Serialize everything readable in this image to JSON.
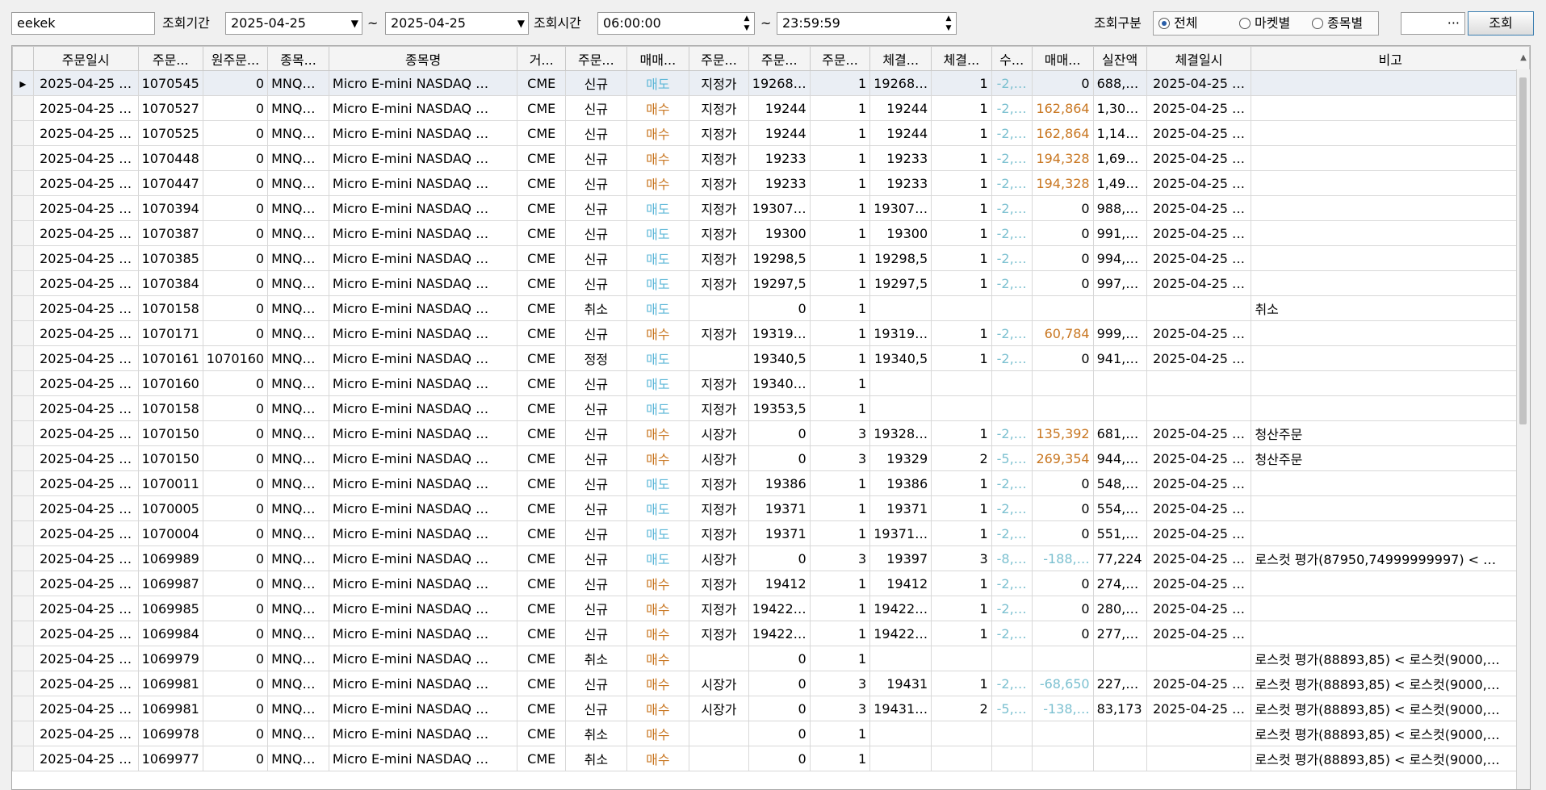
{
  "toolbar": {
    "account": "eekek",
    "period_label": "조회기간",
    "start_date": "2025-04-25",
    "tilde": "~",
    "end_date": "2025-04-25",
    "time_label": "조회시간",
    "start_time": "06:00:00",
    "end_time": "23:59:59",
    "type_label": "조회구분",
    "radio_all": "전체",
    "radio_market": "마켓별",
    "radio_symbol": "종목별",
    "selected_radio": "all",
    "picker_button": "···",
    "search_button": "조회"
  },
  "columns": [
    "주문일시",
    "주문...",
    "원주문...",
    "종목...",
    "종목명",
    "거...",
    "주문...",
    "매매...",
    "주문...",
    "주문...",
    "주문...",
    "체결...",
    "체결...",
    "수...",
    "매매...",
    "실잔액",
    "체결일시",
    "비고"
  ],
  "rows": [
    [
      "2025-04-25 …",
      "1070545",
      "0",
      "MNQ…",
      "Micro E-mini NASDAQ …",
      "CME",
      "신규",
      "매도",
      "지정가",
      "19268…",
      "1",
      "19268…",
      "1",
      "-2,…",
      "0",
      "688,…",
      "2025-04-25 …",
      ""
    ],
    [
      "2025-04-25 …",
      "1070527",
      "0",
      "MNQ…",
      "Micro E-mini NASDAQ …",
      "CME",
      "신규",
      "매수",
      "지정가",
      "19244",
      "1",
      "19244",
      "1",
      "-2,…",
      "162,864",
      "1,30…",
      "2025-04-25 …",
      ""
    ],
    [
      "2025-04-25 …",
      "1070525",
      "0",
      "MNQ…",
      "Micro E-mini NASDAQ …",
      "CME",
      "신규",
      "매수",
      "지정가",
      "19244",
      "1",
      "19244",
      "1",
      "-2,…",
      "162,864",
      "1,14…",
      "2025-04-25 …",
      ""
    ],
    [
      "2025-04-25 …",
      "1070448",
      "0",
      "MNQ…",
      "Micro E-mini NASDAQ …",
      "CME",
      "신규",
      "매수",
      "지정가",
      "19233",
      "1",
      "19233",
      "1",
      "-2,…",
      "194,328",
      "1,69…",
      "2025-04-25 …",
      ""
    ],
    [
      "2025-04-25 …",
      "1070447",
      "0",
      "MNQ…",
      "Micro E-mini NASDAQ …",
      "CME",
      "신규",
      "매수",
      "지정가",
      "19233",
      "1",
      "19233",
      "1",
      "-2,…",
      "194,328",
      "1,49…",
      "2025-04-25 …",
      ""
    ],
    [
      "2025-04-25 …",
      "1070394",
      "0",
      "MNQ…",
      "Micro E-mini NASDAQ …",
      "CME",
      "신규",
      "매도",
      "지정가",
      "19307…",
      "1",
      "19307…",
      "1",
      "-2,…",
      "0",
      "988,…",
      "2025-04-25 …",
      ""
    ],
    [
      "2025-04-25 …",
      "1070387",
      "0",
      "MNQ…",
      "Micro E-mini NASDAQ …",
      "CME",
      "신규",
      "매도",
      "지정가",
      "19300",
      "1",
      "19300",
      "1",
      "-2,…",
      "0",
      "991,…",
      "2025-04-25 …",
      ""
    ],
    [
      "2025-04-25 …",
      "1070385",
      "0",
      "MNQ…",
      "Micro E-mini NASDAQ …",
      "CME",
      "신규",
      "매도",
      "지정가",
      "19298,5",
      "1",
      "19298,5",
      "1",
      "-2,…",
      "0",
      "994,…",
      "2025-04-25 …",
      ""
    ],
    [
      "2025-04-25 …",
      "1070384",
      "0",
      "MNQ…",
      "Micro E-mini NASDAQ …",
      "CME",
      "신규",
      "매도",
      "지정가",
      "19297,5",
      "1",
      "19297,5",
      "1",
      "-2,…",
      "0",
      "997,…",
      "2025-04-25 …",
      ""
    ],
    [
      "2025-04-25 …",
      "1070158",
      "0",
      "MNQ…",
      "Micro E-mini NASDAQ …",
      "CME",
      "취소",
      "매도",
      "",
      "0",
      "1",
      "",
      "",
      "",
      "",
      "",
      "",
      "취소"
    ],
    [
      "2025-04-25 …",
      "1070171",
      "0",
      "MNQ…",
      "Micro E-mini NASDAQ …",
      "CME",
      "신규",
      "매수",
      "지정가",
      "19319…",
      "1",
      "19319…",
      "1",
      "-2,…",
      "60,784",
      "999,…",
      "2025-04-25 …",
      ""
    ],
    [
      "2025-04-25 …",
      "1070161",
      "1070160",
      "MNQ…",
      "Micro E-mini NASDAQ …",
      "CME",
      "정정",
      "매도",
      "",
      "19340,5",
      "1",
      "19340,5",
      "1",
      "-2,…",
      "0",
      "941,…",
      "2025-04-25 …",
      ""
    ],
    [
      "2025-04-25 …",
      "1070160",
      "0",
      "MNQ…",
      "Micro E-mini NASDAQ …",
      "CME",
      "신규",
      "매도",
      "지정가",
      "19340…",
      "1",
      "",
      "",
      "",
      "",
      "",
      "",
      ""
    ],
    [
      "2025-04-25 …",
      "1070158",
      "0",
      "MNQ…",
      "Micro E-mini NASDAQ …",
      "CME",
      "신규",
      "매도",
      "지정가",
      "19353,5",
      "1",
      "",
      "",
      "",
      "",
      "",
      "",
      ""
    ],
    [
      "2025-04-25 …",
      "1070150",
      "0",
      "MNQ…",
      "Micro E-mini NASDAQ …",
      "CME",
      "신규",
      "매수",
      "시장가",
      "0",
      "3",
      "19328…",
      "1",
      "-2,…",
      "135,392",
      "681,…",
      "2025-04-25 …",
      "청산주문"
    ],
    [
      "2025-04-25 …",
      "1070150",
      "0",
      "MNQ…",
      "Micro E-mini NASDAQ …",
      "CME",
      "신규",
      "매수",
      "시장가",
      "0",
      "3",
      "19329",
      "2",
      "-5,…",
      "269,354",
      "944,…",
      "2025-04-25 …",
      "청산주문"
    ],
    [
      "2025-04-25 …",
      "1070011",
      "0",
      "MNQ…",
      "Micro E-mini NASDAQ …",
      "CME",
      "신규",
      "매도",
      "지정가",
      "19386",
      "1",
      "19386",
      "1",
      "-2,…",
      "0",
      "548,…",
      "2025-04-25 …",
      ""
    ],
    [
      "2025-04-25 …",
      "1070005",
      "0",
      "MNQ…",
      "Micro E-mini NASDAQ …",
      "CME",
      "신규",
      "매도",
      "지정가",
      "19371",
      "1",
      "19371",
      "1",
      "-2,…",
      "0",
      "554,…",
      "2025-04-25 …",
      ""
    ],
    [
      "2025-04-25 …",
      "1070004",
      "0",
      "MNQ…",
      "Micro E-mini NASDAQ …",
      "CME",
      "신규",
      "매도",
      "지정가",
      "19371",
      "1",
      "19371…",
      "1",
      "-2,…",
      "0",
      "551,…",
      "2025-04-25 …",
      ""
    ],
    [
      "2025-04-25 …",
      "1069989",
      "0",
      "MNQ…",
      "Micro E-mini NASDAQ …",
      "CME",
      "신규",
      "매도",
      "시장가",
      "0",
      "3",
      "19397",
      "3",
      "-8,…",
      "-188,…",
      "77,224",
      "2025-04-25 …",
      "로스컷 평가(87950,74999999997) < …"
    ],
    [
      "2025-04-25 …",
      "1069987",
      "0",
      "MNQ…",
      "Micro E-mini NASDAQ …",
      "CME",
      "신규",
      "매수",
      "지정가",
      "19412",
      "1",
      "19412",
      "1",
      "-2,…",
      "0",
      "274,…",
      "2025-04-25 …",
      ""
    ],
    [
      "2025-04-25 …",
      "1069985",
      "0",
      "MNQ…",
      "Micro E-mini NASDAQ …",
      "CME",
      "신규",
      "매수",
      "지정가",
      "19422…",
      "1",
      "19422…",
      "1",
      "-2,…",
      "0",
      "280,…",
      "2025-04-25 …",
      ""
    ],
    [
      "2025-04-25 …",
      "1069984",
      "0",
      "MNQ…",
      "Micro E-mini NASDAQ …",
      "CME",
      "신규",
      "매수",
      "지정가",
      "19422…",
      "1",
      "19422…",
      "1",
      "-2,…",
      "0",
      "277,…",
      "2025-04-25 …",
      ""
    ],
    [
      "2025-04-25 …",
      "1069979",
      "0",
      "MNQ…",
      "Micro E-mini NASDAQ …",
      "CME",
      "취소",
      "매수",
      "",
      "0",
      "1",
      "",
      "",
      "",
      "",
      "",
      "",
      "로스컷 평가(88893,85) < 로스컷(9000,…"
    ],
    [
      "2025-04-25 …",
      "1069981",
      "0",
      "MNQ…",
      "Micro E-mini NASDAQ …",
      "CME",
      "신규",
      "매수",
      "시장가",
      "0",
      "3",
      "19431",
      "1",
      "-2,…",
      "-68,650",
      "227,…",
      "2025-04-25 …",
      "로스컷 평가(88893,85) < 로스컷(9000,…"
    ],
    [
      "2025-04-25 …",
      "1069981",
      "0",
      "MNQ…",
      "Micro E-mini NASDAQ …",
      "CME",
      "신규",
      "매수",
      "시장가",
      "0",
      "3",
      "19431…",
      "2",
      "-5,…",
      "-138,…",
      "83,173",
      "2025-04-25 …",
      "로스컷 평가(88893,85) < 로스컷(9000,…"
    ],
    [
      "2025-04-25 …",
      "1069978",
      "0",
      "MNQ…",
      "Micro E-mini NASDAQ …",
      "CME",
      "취소",
      "매수",
      "",
      "0",
      "1",
      "",
      "",
      "",
      "",
      "",
      "",
      "로스컷 평가(88893,85) < 로스컷(9000,…"
    ],
    [
      "2025-04-25 …",
      "1069977",
      "0",
      "MNQ…",
      "Micro E-mini NASDAQ …",
      "CME",
      "취소",
      "매수",
      "",
      "0",
      "1",
      "",
      "",
      "",
      "",
      "",
      "",
      "로스컷 평가(88893,85) < 로스컷(9000,…"
    ]
  ],
  "colors": {
    "sell": "#5fb8d8",
    "buy": "#c87620",
    "negative": "#7bc0d0",
    "positive": "#c87620"
  }
}
